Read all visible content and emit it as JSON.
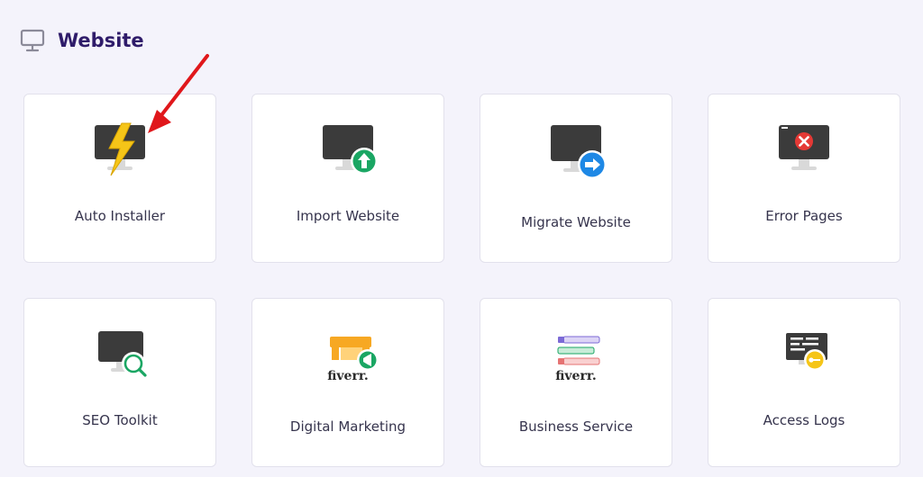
{
  "section": {
    "title": "Website",
    "icon": "monitor-icon"
  },
  "cards": [
    {
      "label": "Auto Installer",
      "icon": "auto-installer-icon"
    },
    {
      "label": "Import Website",
      "icon": "import-website-icon"
    },
    {
      "label": "Migrate Website",
      "icon": "migrate-website-icon"
    },
    {
      "label": "Error Pages",
      "icon": "error-pages-icon"
    },
    {
      "label": "SEO Toolkit",
      "icon": "seo-toolkit-icon"
    },
    {
      "label": "Digital Marketing",
      "icon": "digital-marketing-icon",
      "brand": "fiverr."
    },
    {
      "label": "Business Service",
      "icon": "business-service-icon",
      "brand": "fiverr."
    },
    {
      "label": "Access Logs",
      "icon": "access-logs-icon"
    }
  ],
  "colors": {
    "background": "#f4f3fb",
    "card": "#ffffff",
    "monitor": "#3b3b3b",
    "title": "#2f1c6a",
    "green": "#1aa663",
    "blue": "#1e88e5",
    "red": "#e53935",
    "yellow": "#f5c518",
    "orange": "#f7a823",
    "arrow": "#e0171b"
  }
}
